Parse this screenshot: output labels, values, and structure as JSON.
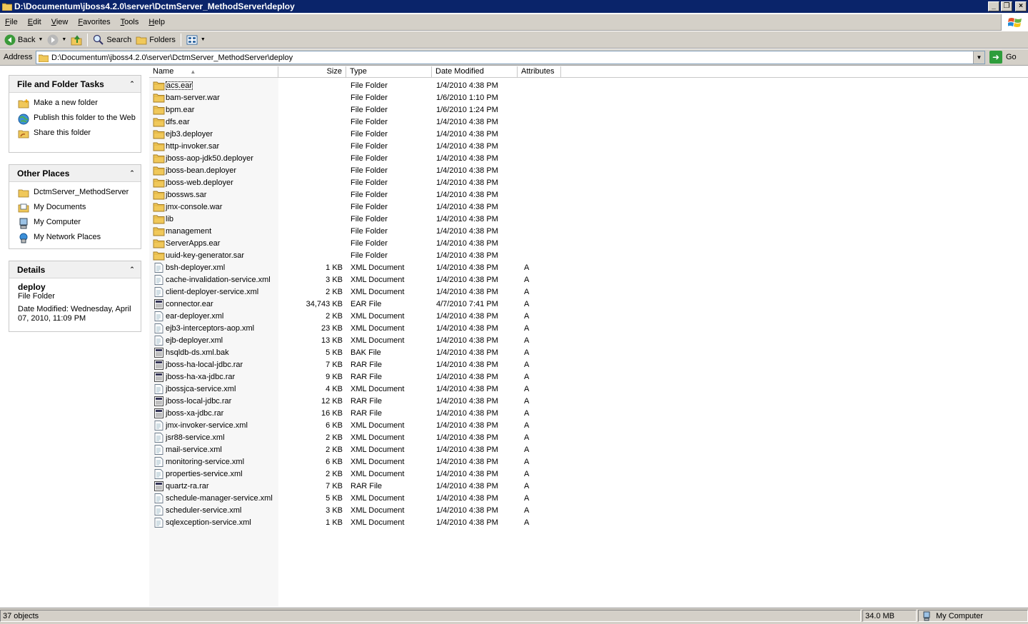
{
  "window": {
    "title": "D:\\Documentum\\jboss4.2.0\\server\\DctmServer_MethodServer\\deploy",
    "minimize_glyph": "_",
    "restore_glyph": "❐",
    "close_glyph": "×"
  },
  "menu": [
    "File",
    "Edit",
    "View",
    "Favorites",
    "Tools",
    "Help"
  ],
  "toolbar": {
    "back_label": "Back",
    "search_label": "Search",
    "folders_label": "Folders"
  },
  "address": {
    "label": "Address",
    "value": "D:\\Documentum\\jboss4.2.0\\server\\DctmServer_MethodServer\\deploy",
    "go_label": "Go"
  },
  "tasks_panel": {
    "title": "File and Folder Tasks",
    "items": [
      {
        "label": "Make a new folder",
        "icon": "new-folder-icon"
      },
      {
        "label": "Publish this folder to the Web",
        "icon": "globe-icon"
      },
      {
        "label": "Share this folder",
        "icon": "share-folder-icon"
      }
    ]
  },
  "places_panel": {
    "title": "Other Places",
    "items": [
      {
        "label": "DctmServer_MethodServer",
        "icon": "folder-icon"
      },
      {
        "label": "My Documents",
        "icon": "documents-icon"
      },
      {
        "label": "My Computer",
        "icon": "computer-icon"
      },
      {
        "label": "My Network Places",
        "icon": "network-icon"
      }
    ]
  },
  "details_panel": {
    "title": "Details",
    "name": "deploy",
    "type": "File Folder",
    "modified": "Date Modified: Wednesday, April 07, 2010, 11:09 PM"
  },
  "columns": {
    "name": "Name",
    "size": "Size",
    "type": "Type",
    "date": "Date Modified",
    "attributes": "Attributes"
  },
  "files": [
    {
      "name": "acs.ear",
      "size": "",
      "type": "File Folder",
      "date": "1/4/2010 4:38 PM",
      "attr": "",
      "icon": "folder"
    },
    {
      "name": "bam-server.war",
      "size": "",
      "type": "File Folder",
      "date": "1/6/2010 1:10 PM",
      "attr": "",
      "icon": "folder"
    },
    {
      "name": "bpm.ear",
      "size": "",
      "type": "File Folder",
      "date": "1/6/2010 1:24 PM",
      "attr": "",
      "icon": "folder"
    },
    {
      "name": "dfs.ear",
      "size": "",
      "type": "File Folder",
      "date": "1/4/2010 4:38 PM",
      "attr": "",
      "icon": "folder"
    },
    {
      "name": "ejb3.deployer",
      "size": "",
      "type": "File Folder",
      "date": "1/4/2010 4:38 PM",
      "attr": "",
      "icon": "folder"
    },
    {
      "name": "http-invoker.sar",
      "size": "",
      "type": "File Folder",
      "date": "1/4/2010 4:38 PM",
      "attr": "",
      "icon": "folder"
    },
    {
      "name": "jboss-aop-jdk50.deployer",
      "size": "",
      "type": "File Folder",
      "date": "1/4/2010 4:38 PM",
      "attr": "",
      "icon": "folder"
    },
    {
      "name": "jboss-bean.deployer",
      "size": "",
      "type": "File Folder",
      "date": "1/4/2010 4:38 PM",
      "attr": "",
      "icon": "folder"
    },
    {
      "name": "jboss-web.deployer",
      "size": "",
      "type": "File Folder",
      "date": "1/4/2010 4:38 PM",
      "attr": "",
      "icon": "folder"
    },
    {
      "name": "jbossws.sar",
      "size": "",
      "type": "File Folder",
      "date": "1/4/2010 4:38 PM",
      "attr": "",
      "icon": "folder"
    },
    {
      "name": "jmx-console.war",
      "size": "",
      "type": "File Folder",
      "date": "1/4/2010 4:38 PM",
      "attr": "",
      "icon": "folder"
    },
    {
      "name": "lib",
      "size": "",
      "type": "File Folder",
      "date": "1/4/2010 4:38 PM",
      "attr": "",
      "icon": "folder"
    },
    {
      "name": "management",
      "size": "",
      "type": "File Folder",
      "date": "1/4/2010 4:38 PM",
      "attr": "",
      "icon": "folder"
    },
    {
      "name": "ServerApps.ear",
      "size": "",
      "type": "File Folder",
      "date": "1/4/2010 4:38 PM",
      "attr": "",
      "icon": "folder"
    },
    {
      "name": "uuid-key-generator.sar",
      "size": "",
      "type": "File Folder",
      "date": "1/4/2010 4:38 PM",
      "attr": "",
      "icon": "folder"
    },
    {
      "name": "bsh-deployer.xml",
      "size": "1 KB",
      "type": "XML Document",
      "date": "1/4/2010 4:38 PM",
      "attr": "A",
      "icon": "xml"
    },
    {
      "name": "cache-invalidation-service.xml",
      "size": "3 KB",
      "type": "XML Document",
      "date": "1/4/2010 4:38 PM",
      "attr": "A",
      "icon": "xml"
    },
    {
      "name": "client-deployer-service.xml",
      "size": "2 KB",
      "type": "XML Document",
      "date": "1/4/2010 4:38 PM",
      "attr": "A",
      "icon": "xml"
    },
    {
      "name": "connector.ear",
      "size": "34,743 KB",
      "type": "EAR File",
      "date": "4/7/2010 7:41 PM",
      "attr": "A",
      "icon": "archive"
    },
    {
      "name": "ear-deployer.xml",
      "size": "2 KB",
      "type": "XML Document",
      "date": "1/4/2010 4:38 PM",
      "attr": "A",
      "icon": "xml"
    },
    {
      "name": "ejb3-interceptors-aop.xml",
      "size": "23 KB",
      "type": "XML Document",
      "date": "1/4/2010 4:38 PM",
      "attr": "A",
      "icon": "xml"
    },
    {
      "name": "ejb-deployer.xml",
      "size": "13 KB",
      "type": "XML Document",
      "date": "1/4/2010 4:38 PM",
      "attr": "A",
      "icon": "xml"
    },
    {
      "name": "hsqldb-ds.xml.bak",
      "size": "5 KB",
      "type": "BAK File",
      "date": "1/4/2010 4:38 PM",
      "attr": "A",
      "icon": "archive"
    },
    {
      "name": "jboss-ha-local-jdbc.rar",
      "size": "7 KB",
      "type": "RAR File",
      "date": "1/4/2010 4:38 PM",
      "attr": "A",
      "icon": "archive"
    },
    {
      "name": "jboss-ha-xa-jdbc.rar",
      "size": "9 KB",
      "type": "RAR File",
      "date": "1/4/2010 4:38 PM",
      "attr": "A",
      "icon": "archive"
    },
    {
      "name": "jbossjca-service.xml",
      "size": "4 KB",
      "type": "XML Document",
      "date": "1/4/2010 4:38 PM",
      "attr": "A",
      "icon": "xml"
    },
    {
      "name": "jboss-local-jdbc.rar",
      "size": "12 KB",
      "type": "RAR File",
      "date": "1/4/2010 4:38 PM",
      "attr": "A",
      "icon": "archive"
    },
    {
      "name": "jboss-xa-jdbc.rar",
      "size": "16 KB",
      "type": "RAR File",
      "date": "1/4/2010 4:38 PM",
      "attr": "A",
      "icon": "archive"
    },
    {
      "name": "jmx-invoker-service.xml",
      "size": "6 KB",
      "type": "XML Document",
      "date": "1/4/2010 4:38 PM",
      "attr": "A",
      "icon": "xml"
    },
    {
      "name": "jsr88-service.xml",
      "size": "2 KB",
      "type": "XML Document",
      "date": "1/4/2010 4:38 PM",
      "attr": "A",
      "icon": "xml"
    },
    {
      "name": "mail-service.xml",
      "size": "2 KB",
      "type": "XML Document",
      "date": "1/4/2010 4:38 PM",
      "attr": "A",
      "icon": "xml"
    },
    {
      "name": "monitoring-service.xml",
      "size": "6 KB",
      "type": "XML Document",
      "date": "1/4/2010 4:38 PM",
      "attr": "A",
      "icon": "xml"
    },
    {
      "name": "properties-service.xml",
      "size": "2 KB",
      "type": "XML Document",
      "date": "1/4/2010 4:38 PM",
      "attr": "A",
      "icon": "xml"
    },
    {
      "name": "quartz-ra.rar",
      "size": "7 KB",
      "type": "RAR File",
      "date": "1/4/2010 4:38 PM",
      "attr": "A",
      "icon": "archive"
    },
    {
      "name": "schedule-manager-service.xml",
      "size": "5 KB",
      "type": "XML Document",
      "date": "1/4/2010 4:38 PM",
      "attr": "A",
      "icon": "xml"
    },
    {
      "name": "scheduler-service.xml",
      "size": "3 KB",
      "type": "XML Document",
      "date": "1/4/2010 4:38 PM",
      "attr": "A",
      "icon": "xml"
    },
    {
      "name": "sqlexception-service.xml",
      "size": "1 KB",
      "type": "XML Document",
      "date": "1/4/2010 4:38 PM",
      "attr": "A",
      "icon": "xml"
    }
  ],
  "status": {
    "count": "37 objects",
    "size": "34.0 MB",
    "zone": "My Computer"
  },
  "colors": {
    "titlebar": "#0a246a",
    "chrome": "#d4d0c8",
    "folder": "#f0c85a",
    "go": "#2e9d3b"
  }
}
